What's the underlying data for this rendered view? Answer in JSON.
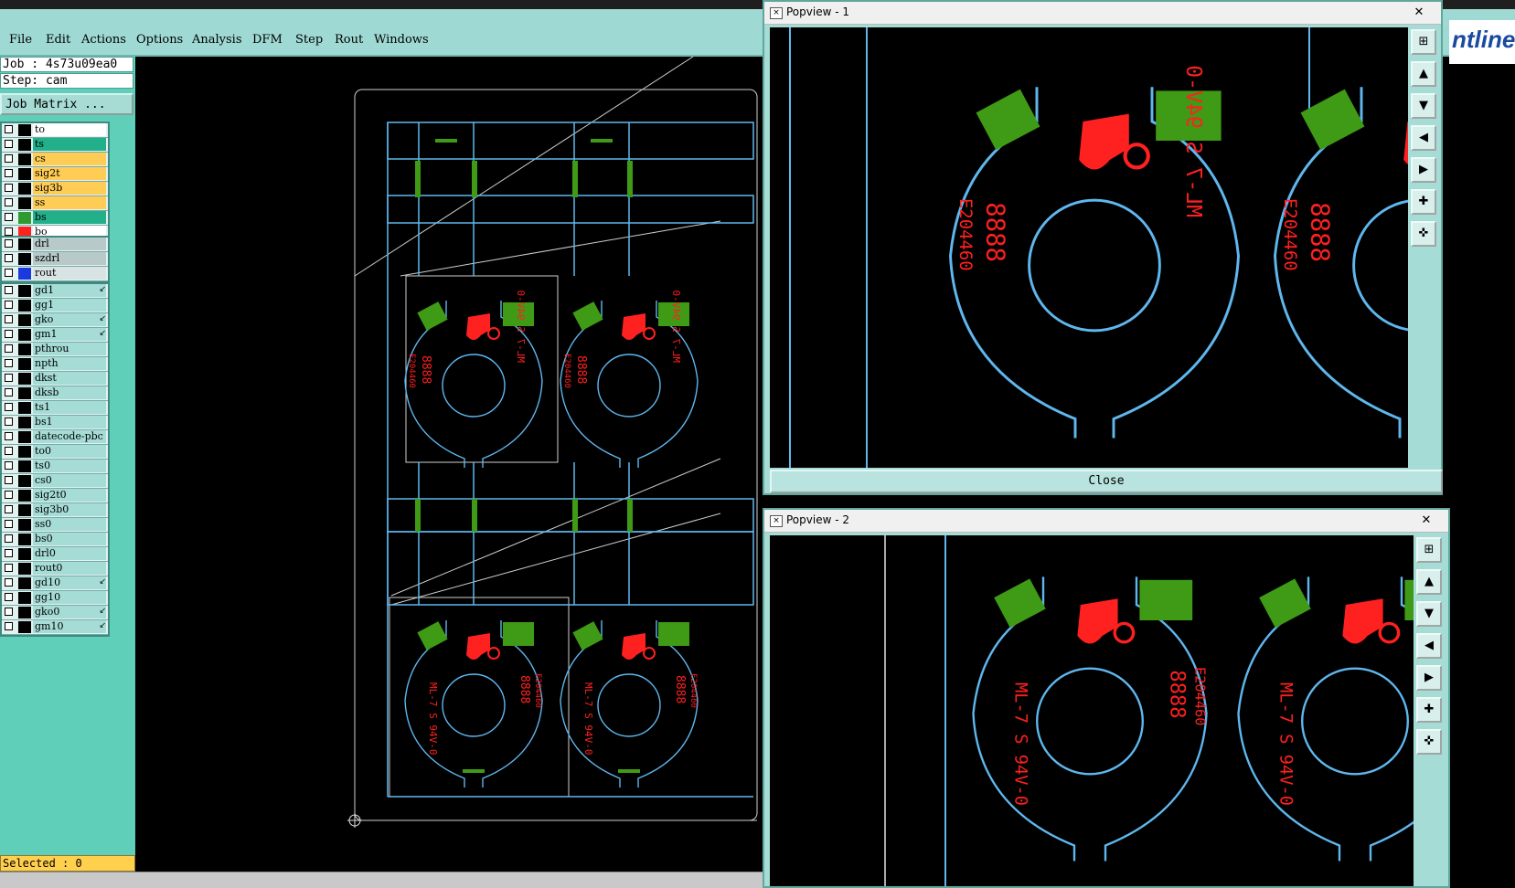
{
  "menu": {
    "items": [
      {
        "label": "File"
      },
      {
        "label": "Edit"
      },
      {
        "label": "Actions"
      },
      {
        "label": "Options"
      },
      {
        "label": "Analysis"
      },
      {
        "label": "DFM"
      },
      {
        "label": "Step"
      },
      {
        "label": "Rout"
      },
      {
        "label": "Windows"
      }
    ],
    "brand": "ntline"
  },
  "left_panel": {
    "job": "Job : 4s73u09ea0",
    "step": "Step: cam",
    "job_matrix_label": "Job Matrix ...",
    "selected": "Selected : 0",
    "layers_group1": [
      {
        "name": "to",
        "color": "#ffffff",
        "swatch": "#000000"
      },
      {
        "name": "ts",
        "color": "#22b08a",
        "swatch": "#000000"
      },
      {
        "name": "cs",
        "color": "#ffcc55",
        "swatch": "#000000"
      },
      {
        "name": "sig2t",
        "color": "#ffcc55",
        "swatch": "#000000"
      },
      {
        "name": "sig3b",
        "color": "#ffcc55",
        "swatch": "#000000"
      },
      {
        "name": "ss",
        "color": "#ffcc55",
        "swatch": "#000000"
      },
      {
        "name": "bs",
        "color": "#22b08a",
        "swatch": "#2f9a2f"
      },
      {
        "name": "bo",
        "color": "#ffffff",
        "swatch": "#ff2020"
      }
    ],
    "layers_group2": [
      {
        "name": "drl",
        "color": "#b7c9c9",
        "swatch": "#000000"
      },
      {
        "name": "szdrl",
        "color": "#b7c9c9",
        "swatch": "#000000"
      },
      {
        "name": "rout",
        "color": "#d9e3e3",
        "swatch": "#1a3ae0"
      }
    ],
    "layers_group3": [
      {
        "name": "gd1",
        "mark": "↙"
      },
      {
        "name": "gg1",
        "mark": ""
      },
      {
        "name": "gko",
        "mark": "↙"
      },
      {
        "name": "gm1",
        "mark": "↙"
      },
      {
        "name": "pthrou",
        "mark": ""
      },
      {
        "name": "npth",
        "mark": ""
      },
      {
        "name": "dkst",
        "mark": ""
      },
      {
        "name": "dksb",
        "mark": ""
      },
      {
        "name": "ts1",
        "mark": ""
      },
      {
        "name": "bs1",
        "mark": ""
      },
      {
        "name": "datecode-pbc",
        "mark": ""
      },
      {
        "name": "to0",
        "mark": ""
      },
      {
        "name": "ts0",
        "mark": ""
      },
      {
        "name": "cs0",
        "mark": ""
      },
      {
        "name": "sig2t0",
        "mark": ""
      },
      {
        "name": "sig3b0",
        "mark": ""
      },
      {
        "name": "ss0",
        "mark": ""
      },
      {
        "name": "bs0",
        "mark": ""
      },
      {
        "name": "drl0",
        "mark": ""
      },
      {
        "name": "rout0",
        "mark": ""
      },
      {
        "name": "gd10",
        "mark": "↙"
      },
      {
        "name": "gg10",
        "mark": ""
      },
      {
        "name": "gko0",
        "mark": "↙"
      },
      {
        "name": "gm10",
        "mark": "↙"
      }
    ]
  },
  "popview1": {
    "title": "Popview - 1",
    "close_label": "Close",
    "x_label": "✕"
  },
  "popview2": {
    "title": "Popview - 2",
    "x_label": "✕"
  },
  "board_text": {
    "part": "ML-7 S 94V-0",
    "code": "E204460",
    "digits": "8888"
  },
  "colors": {
    "outline": "#5fb7ee",
    "copper": "#3f9a16",
    "silk": "#ff2020",
    "menubar": "#9fd9d3",
    "panel": "#5fcfba"
  }
}
